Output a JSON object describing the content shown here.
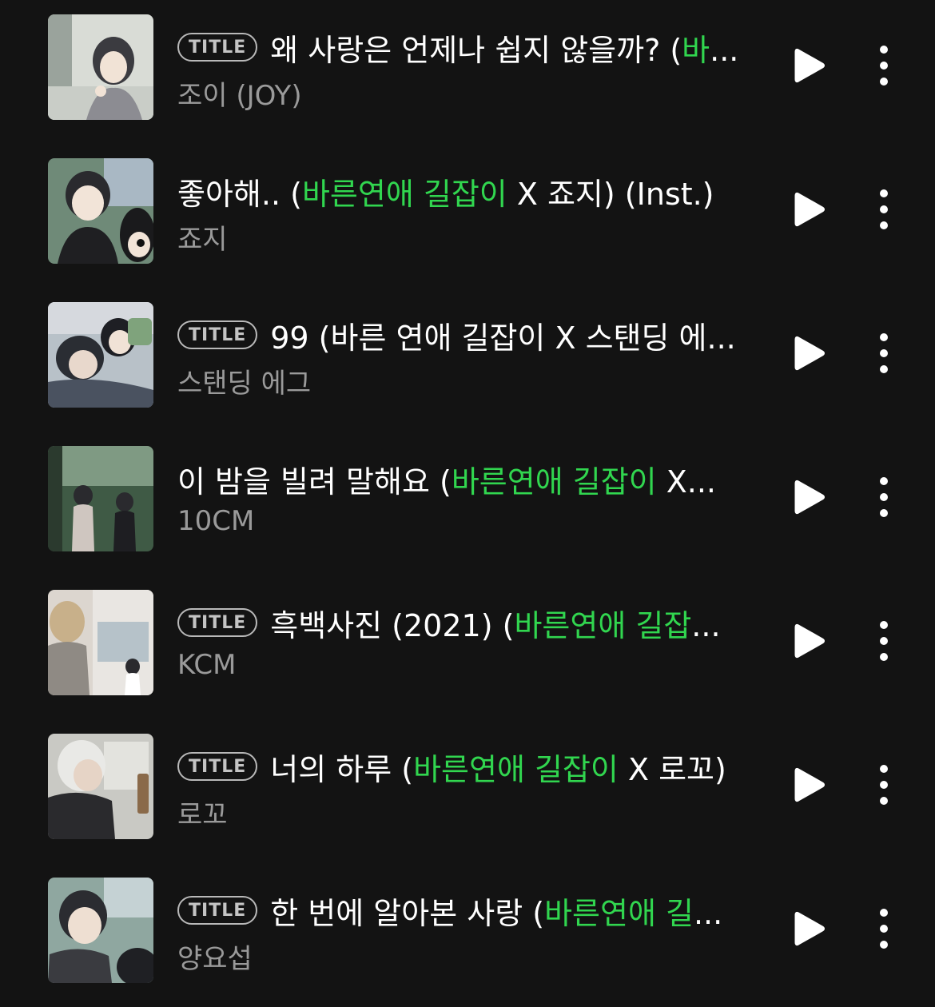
{
  "colors": {
    "background": "#131313",
    "title": "#ffffff",
    "highlight": "#31d64f",
    "artist": "#9a9a9a",
    "badge": "#c4c4c4"
  },
  "badge_label": "TITLE",
  "tracks": [
    {
      "has_badge": true,
      "title": {
        "pre": "왜 사랑은 언제나 쉽지 않을까? (",
        "hl": "바",
        "post": "..."
      },
      "artist": "조이 (JOY)",
      "cover": {
        "icon": "album-cover-icon",
        "caption": "왜 사랑은 언제나 쉽지 않을까?"
      }
    },
    {
      "has_badge": false,
      "title": {
        "pre": "좋아해.. (",
        "hl": "바른연애 길잡이",
        "post": " X 죠지) (Inst.)"
      },
      "artist": "죠지",
      "cover": {
        "icon": "album-cover-icon",
        "caption": "좋아해.."
      }
    },
    {
      "has_badge": true,
      "title": {
        "pre": "99 (바른 연애 길잡이 X 스탠딩 에...",
        "hl": "",
        "post": ""
      },
      "artist": "스탠딩 에그",
      "cover": {
        "icon": "album-cover-icon",
        "caption": "99%"
      }
    },
    {
      "has_badge": false,
      "title": {
        "pre": "이 밤을 빌려 말해요 (",
        "hl": "바른연애 길잡이",
        "post": " X..."
      },
      "artist": "10CM",
      "cover": {
        "icon": "album-cover-icon",
        "caption": "이 밤을 빌려 말해요"
      }
    },
    {
      "has_badge": true,
      "title": {
        "pre": "흑백사진 (2021) (",
        "hl": "바른연애 길잡",
        "post": "..."
      },
      "artist": "KCM",
      "cover": {
        "icon": "album-cover-icon",
        "caption": "흑백사진 (2021)"
      }
    },
    {
      "has_badge": true,
      "title": {
        "pre": "너의 하루 (",
        "hl": "바른연애 길잡이",
        "post": " X 로꼬)"
      },
      "artist": "로꼬",
      "cover": {
        "icon": "album-cover-icon",
        "caption": "너의 하루"
      }
    },
    {
      "has_badge": true,
      "title": {
        "pre": "한 번에 알아본 사랑 (",
        "hl": "바른연애 길",
        "post": "..."
      },
      "artist": "양요섭",
      "cover": {
        "icon": "album-cover-icon",
        "caption": "한 번에 알아본 사랑"
      }
    }
  ]
}
